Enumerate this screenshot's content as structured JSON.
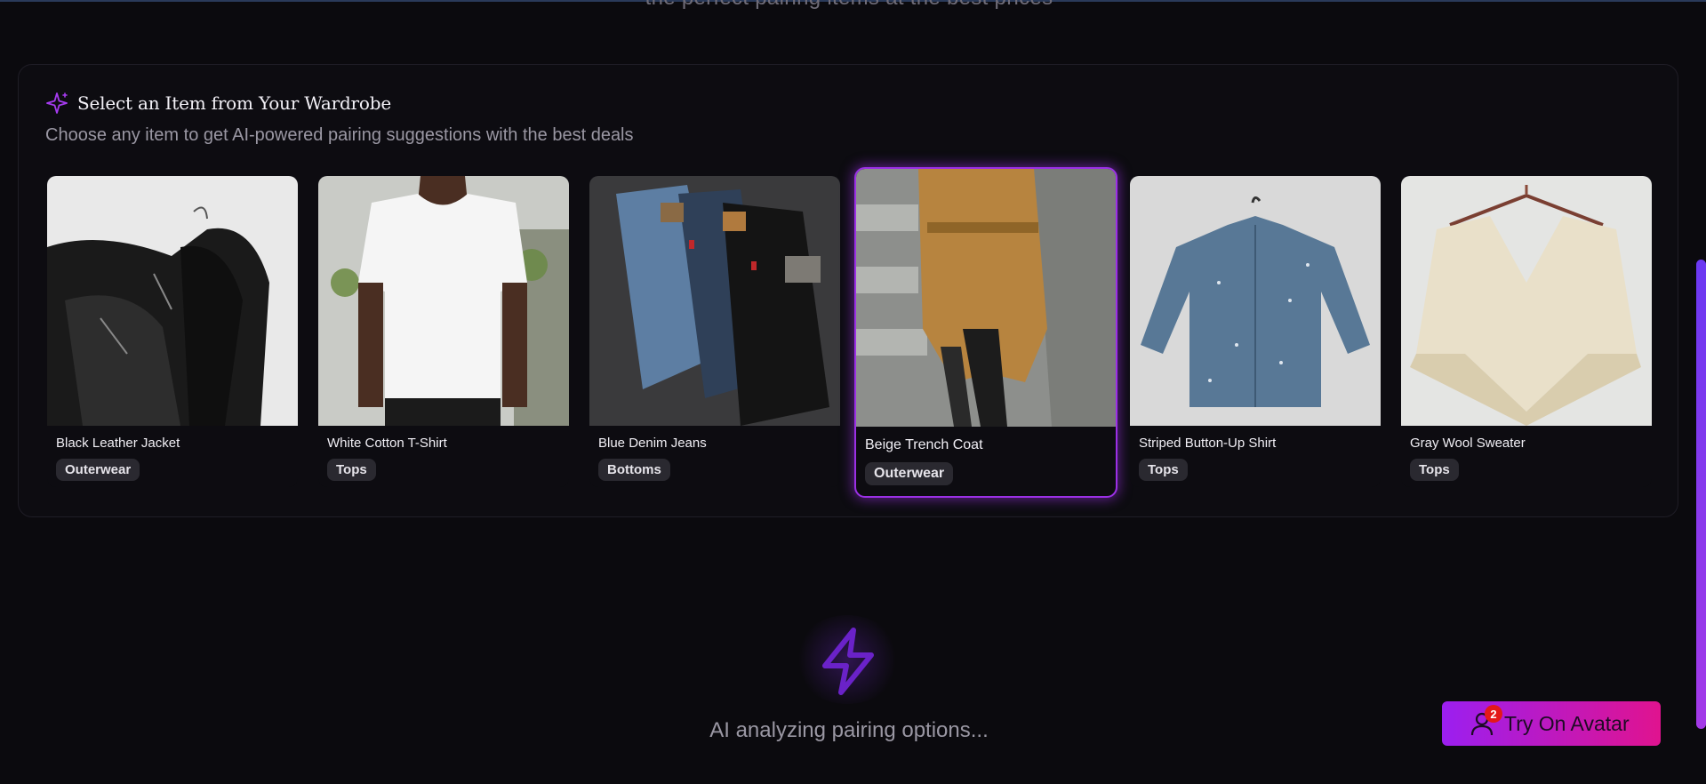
{
  "header": {
    "clipped_text": "the perfect pairing items at the best prices"
  },
  "wardrobe": {
    "title": "Select an Item from Your Wardrobe",
    "subtitle": "Choose any item to get AI-powered pairing suggestions with the best deals",
    "items": [
      {
        "name": "Black Leather Jacket",
        "category": "Outerwear",
        "selected": false
      },
      {
        "name": "White Cotton T-Shirt",
        "category": "Tops",
        "selected": false
      },
      {
        "name": "Blue Denim Jeans",
        "category": "Bottoms",
        "selected": false
      },
      {
        "name": "Beige Trench Coat",
        "category": "Outerwear",
        "selected": true
      },
      {
        "name": "Striped Button-Up Shirt",
        "category": "Tops",
        "selected": false
      },
      {
        "name": "Gray Wool Sweater",
        "category": "Tops",
        "selected": false
      }
    ]
  },
  "status": {
    "text": "AI analyzing pairing options...",
    "icon": "lightning-icon"
  },
  "avatar_button": {
    "label": "Try On Avatar",
    "badge_count": "2",
    "icon": "user-icon"
  },
  "colors": {
    "accent": "#9b30e6",
    "button_start": "#9b1ff0",
    "button_end": "#e0138f",
    "badge": "#e41818"
  }
}
